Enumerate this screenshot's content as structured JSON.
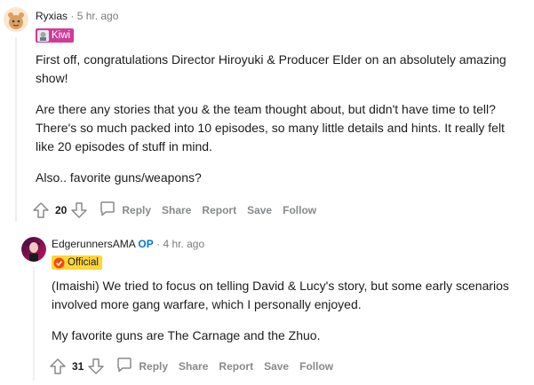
{
  "comments": [
    {
      "author": "Ryxias",
      "separator": "·",
      "time": "5 hr. ago",
      "flair": "Kiwi",
      "paragraphs": [
        "First off, congratulations Director Hiroyuki & Producer Elder on an absolutely amazing show!",
        "Are there any stories that you & the team thought about, but didn't have time to tell? There's so much packed into 10 episodes, so many little details and hints. It really felt like 20 episodes of stuff in mind.",
        "Also.. favorite guns/weapons?"
      ],
      "score": "20",
      "actions": {
        "reply": "Reply",
        "share": "Share",
        "report": "Report",
        "save": "Save",
        "follow": "Follow"
      }
    },
    {
      "author": "EdgerunnersAMA",
      "op_badge": "OP",
      "separator": "·",
      "time": "4 hr. ago",
      "flair": "Official",
      "paragraphs": [
        "(Imaishi) We tried to focus on telling David & Lucy's story, but some early scenarios involved more gang warfare, which I personally enjoyed.",
        "My favorite guns are The Carnage and the Zhuo."
      ],
      "score": "31",
      "actions": {
        "reply": "Reply",
        "share": "Share",
        "report": "Report",
        "save": "Save",
        "follow": "Follow"
      }
    }
  ],
  "colors": {
    "kiwi_flair_bg": "#cc3d99",
    "official_flair_bg": "#ffd635",
    "op_blue": "#0079d3",
    "muted": "#878a8c",
    "thread_line": "#edeff1"
  },
  "icons": [
    "snoo-avatar-icon",
    "cyberpunk-avatar-icon",
    "kiwi-flair-icon",
    "official-flair-icon",
    "upvote-icon",
    "downvote-icon",
    "comment-bubble-icon"
  ]
}
